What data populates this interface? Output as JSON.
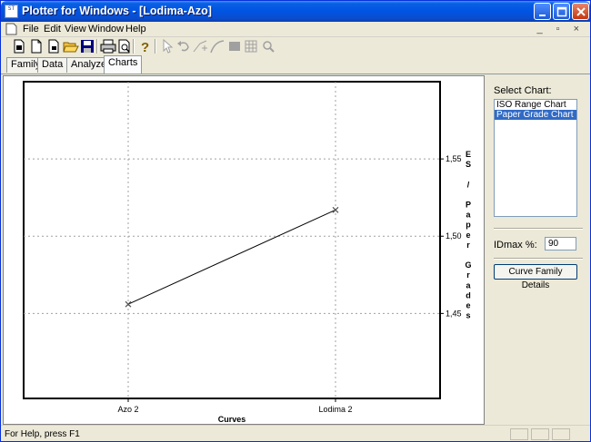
{
  "window": {
    "title": "Plotter for Windows - [Lodima-Azo]",
    "icon_text": "ST"
  },
  "menu": {
    "items": [
      "File",
      "Edit",
      "View",
      "Window",
      "Help"
    ],
    "mdi_buttons": "_ ▫ ×"
  },
  "toolbar": {
    "icons": [
      "new-family-icon",
      "new-icon",
      "open-icon",
      "open-folder-icon",
      "save-icon",
      "print-icon",
      "print-preview-icon",
      "help-icon",
      "pointer-icon",
      "undo-icon",
      "add-point-icon",
      "curve-icon",
      "fill-icon",
      "grid-icon",
      "zoom-icon"
    ]
  },
  "tabs": [
    {
      "label": "Family"
    },
    {
      "label": "Data"
    },
    {
      "label": "Analyze"
    },
    {
      "label": "Charts",
      "active": true
    }
  ],
  "right_panel": {
    "select_chart_label": "Select Chart:",
    "chart_options": [
      {
        "label": "ISO Range Chart",
        "selected": false
      },
      {
        "label": "Paper Grade Chart",
        "selected": true
      }
    ],
    "idmax_label": "IDmax %:",
    "idmax_value": "90",
    "details_button": "Curve Family Details"
  },
  "status": {
    "text": "For Help, press F1"
  },
  "chart_data": {
    "type": "line",
    "categories": [
      "Azo 2",
      "Lodima 2"
    ],
    "series": [
      {
        "values": [
          1.456,
          1.517
        ]
      }
    ],
    "xlabel": "Curves",
    "ylabel": "ES / Paper Grades",
    "ylabel_chars": [
      "E",
      "S",
      "",
      "/",
      "",
      "P",
      "a",
      "p",
      "e",
      "r",
      "",
      "G",
      "r",
      "a",
      "d",
      "e",
      "s"
    ],
    "y_ticks": [
      "1,45",
      "1,50",
      "1,55"
    ],
    "y_tick_values": [
      1.45,
      1.5,
      1.55
    ],
    "ylim": [
      1.395,
      1.6
    ],
    "grid": true,
    "colors": {
      "line": "#000000",
      "marker": "#555555",
      "grid": "#a0a0a0"
    }
  }
}
